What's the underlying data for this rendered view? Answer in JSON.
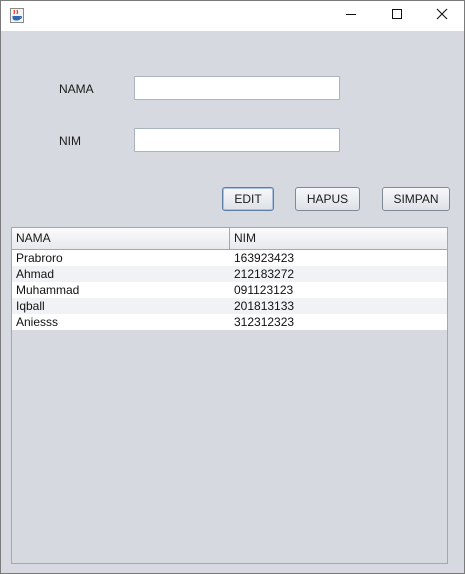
{
  "window": {
    "icon": "java-cup-icon",
    "controls": [
      "minimize-icon",
      "maximize-icon",
      "close-icon"
    ]
  },
  "form": {
    "nama_label": "NAMA",
    "nama_value": "",
    "nim_label": "NIM",
    "nim_value": ""
  },
  "buttons": {
    "edit": "EDIT",
    "hapus": "HAPUS",
    "simpan": "SIMPAN"
  },
  "table": {
    "columns": [
      "NAMA",
      "NIM"
    ],
    "rows": [
      [
        "Prabroro",
        "163923423"
      ],
      [
        "Ahmad",
        "212183272"
      ],
      [
        "Muhammad",
        "091123123"
      ],
      [
        "Iqball",
        "201813133"
      ],
      [
        "Aniesss",
        "312312323"
      ]
    ]
  },
  "colors": {
    "background": "#d6d9df",
    "titlebar": "#ffffff",
    "row_alt": "#f1f2f5"
  }
}
